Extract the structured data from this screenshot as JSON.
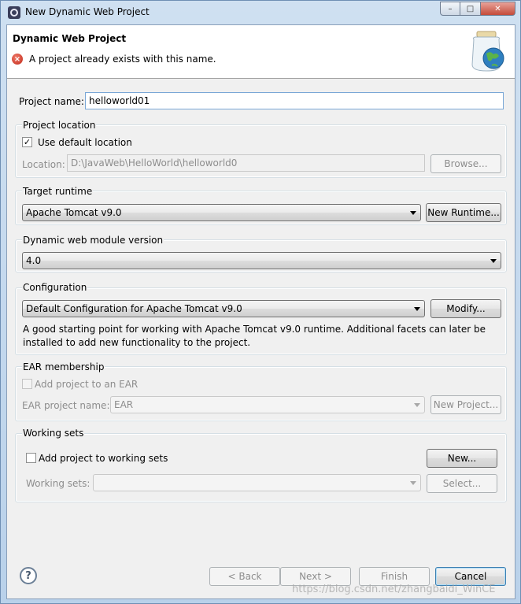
{
  "window": {
    "title": "New Dynamic Web Project"
  },
  "banner": {
    "title": "Dynamic Web Project",
    "message": "A project already exists with this name."
  },
  "project_name": {
    "label": "Project name:",
    "value": "helloworld01"
  },
  "project_location": {
    "group_label": "Project location",
    "use_default_label": "Use default location",
    "use_default_checked": true,
    "location_label": "Location:",
    "location_value": "D:\\JavaWeb\\HelloWorld\\helloworld0",
    "browse_label": "Browse..."
  },
  "target_runtime": {
    "group_label": "Target runtime",
    "selected": "Apache Tomcat v9.0",
    "new_runtime_label": "New Runtime..."
  },
  "module_version": {
    "group_label": "Dynamic web module version",
    "selected": "4.0"
  },
  "configuration": {
    "group_label": "Configuration",
    "selected": "Default Configuration for Apache Tomcat v9.0",
    "modify_label": "Modify...",
    "description": "A good starting point for working with Apache Tomcat v9.0 runtime. Additional facets can later be installed to add new functionality to the project."
  },
  "ear": {
    "group_label": "EAR membership",
    "add_label": "Add project to an EAR",
    "project_name_label": "EAR project name:",
    "project_name_value": "EAR",
    "new_project_label": "New Project..."
  },
  "working_sets": {
    "group_label": "Working sets",
    "add_label": "Add project to working sets",
    "new_label": "New...",
    "sets_label": "Working sets:",
    "sets_value": "",
    "select_label": "Select..."
  },
  "footer": {
    "help": "?",
    "back_label": "< Back",
    "next_label": "Next >",
    "finish_label": "Finish",
    "cancel_label": "Cancel"
  },
  "watermark": "https://blog.csdn.net/zhangbaidi_WinCE"
}
